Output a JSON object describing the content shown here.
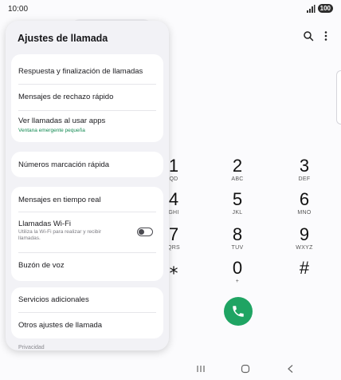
{
  "status_bar": {
    "time": "10:00",
    "battery": "100",
    "icons": [
      "signal-icon",
      "battery-icon"
    ]
  },
  "phone_app": {
    "toolbar_icons": [
      "search-icon",
      "more-options-icon"
    ],
    "dialpad": [
      {
        "num": "1",
        "letters": "QD"
      },
      {
        "num": "2",
        "letters": "ABC"
      },
      {
        "num": "3",
        "letters": "DEF"
      },
      {
        "num": "4",
        "letters": "GHI"
      },
      {
        "num": "5",
        "letters": "JKL"
      },
      {
        "num": "6",
        "letters": "MNO"
      },
      {
        "num": "7",
        "letters": "QRS"
      },
      {
        "num": "8",
        "letters": "TUV"
      },
      {
        "num": "9",
        "letters": "WXYZ"
      },
      {
        "num": "⁎",
        "letters": ""
      },
      {
        "num": "0",
        "letters": "+"
      },
      {
        "num": "#",
        "letters": ""
      }
    ],
    "call_button_color": "#1fa463",
    "call_icon": "phone-icon"
  },
  "settings_panel": {
    "title": "Ajustes de llamada",
    "group1": {
      "answer_end": "Respuesta y finalización de llamadas",
      "quick_reject": "Mensajes de rechazo rápido",
      "calls_over_apps": "Ver llamadas al usar apps",
      "calls_over_apps_sub": "Ventana emergente pequeña"
    },
    "group2": {
      "speed_dial": "Números marcación rápida"
    },
    "group3": {
      "rtt": "Mensajes en tiempo real",
      "wifi_calling": "Llamadas Wi-Fi",
      "wifi_calling_sub": "Utiliza la Wi-Fi para realizar y recibir llamadas.",
      "wifi_calling_enabled": false,
      "voicemail": "Buzón de voz"
    },
    "group4": {
      "supplementary": "Servicios adicionales",
      "other_settings": "Otros ajustes de llamada"
    },
    "privacy_header": "Privacidad",
    "accent_color": "#138a52"
  },
  "nav_bar": {
    "buttons": [
      "recents-icon",
      "home-icon",
      "back-icon"
    ]
  }
}
